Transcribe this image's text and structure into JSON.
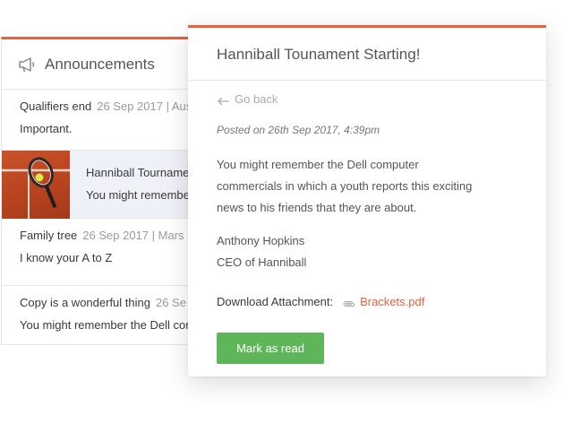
{
  "announcements": {
    "title": "Announcements",
    "items": [
      {
        "title": "Qualifiers end",
        "meta": "26 Sep 2017 | Aus",
        "snippet": "Important."
      },
      {
        "title": "Hanniball Tourname",
        "snippet": "You might remembe",
        "thumbnail": "tennis-racket-clay"
      },
      {
        "title": "Family tree",
        "meta": "26 Sep 2017 | Mars",
        "snippet": "I know your A to Z"
      },
      {
        "title": "Copy is a wonderful thing",
        "meta": "26 Se",
        "snippet": "You might remember the Dell com"
      }
    ]
  },
  "detail": {
    "title": "Hanniball Tounament Starting!",
    "back_label": "Go back",
    "posted": "Posted on 26th Sep 2017, 4:39pm",
    "body_lines": [
      "You might remember the Dell computer",
      "commercials in which a youth reports this exciting",
      "news to his friends that they are about."
    ],
    "signature_name": "Anthony Hopkins",
    "signature_title": "CEO of Hanniball",
    "download_label": "Download Attachment:",
    "attachment": "Brackets.pdf",
    "mark_read_label": "Mark as read"
  },
  "colors": {
    "accent": "#e8603c",
    "button": "#5fb55a",
    "active_row": "#eef1f7"
  },
  "icons": [
    "megaphone-icon",
    "arrow-left-icon",
    "paperclip-icon"
  ]
}
